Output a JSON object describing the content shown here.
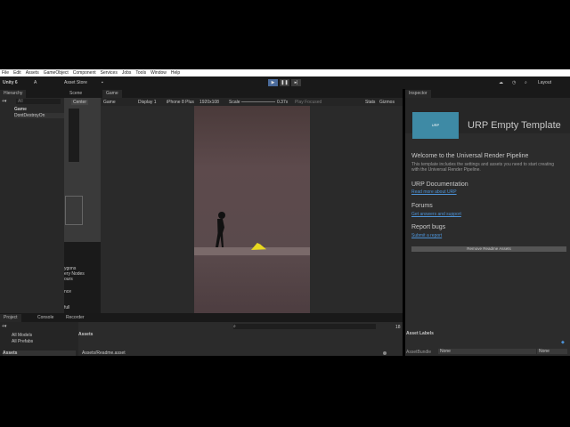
{
  "menu": [
    "File",
    "Edit",
    "Assets",
    "GameObject",
    "Component",
    "Services",
    "Jobs",
    "Tools",
    "Window",
    "Help"
  ],
  "toolbar": {
    "unity": "Unity 6",
    "account": "A",
    "asset_store": "Asset Store",
    "layout": "Layout"
  },
  "hierarchy": {
    "tab": "Hierarchy",
    "search_placeholder": "All",
    "items": [
      "Game",
      "DontDestroyOn"
    ]
  },
  "scene": {
    "tab": "Scene",
    "pivot": "Center",
    "overlay_items": [
      "ygons",
      "ery Nodes",
      "ours",
      "nce",
      "full"
    ]
  },
  "game": {
    "tab": "Game",
    "view": "Game",
    "display": "Display 1",
    "device": "iPhone 8 Plus",
    "resolution": "1920x108",
    "scale_label": "Scale",
    "scale": "0.37x",
    "play_mode": "Play Focused",
    "stats": "Stats",
    "gizmos": "Gizmos"
  },
  "inspector": {
    "tab": "Inspector",
    "title": "URP Empty Template",
    "logo": "URP",
    "welcome_h": "Welcome to the Universal Render Pipeline",
    "welcome_p": "This template includes the settings and assets you need to start creating with the Universal Render Pipeline.",
    "doc_h": "URP Documentation",
    "doc_link": "Read more about URP",
    "forums_h": "Forums",
    "forums_link": "Get answers and support",
    "bugs_h": "Report bugs",
    "bugs_link": "Submit a report",
    "remove_btn": "Remove Readme Assets",
    "asset_labels": "Asset Labels",
    "assetbundle_label": "AssetBundle",
    "bundle": "None",
    "variant": "None"
  },
  "project": {
    "tabs": [
      "Project",
      "Console",
      "Recorder"
    ],
    "favorites": [
      "All Models",
      "All Prefabs"
    ],
    "assets_root": "Assets",
    "breadcrumb": "Assets",
    "path": "Assets/Readme.asset",
    "count": "18"
  }
}
